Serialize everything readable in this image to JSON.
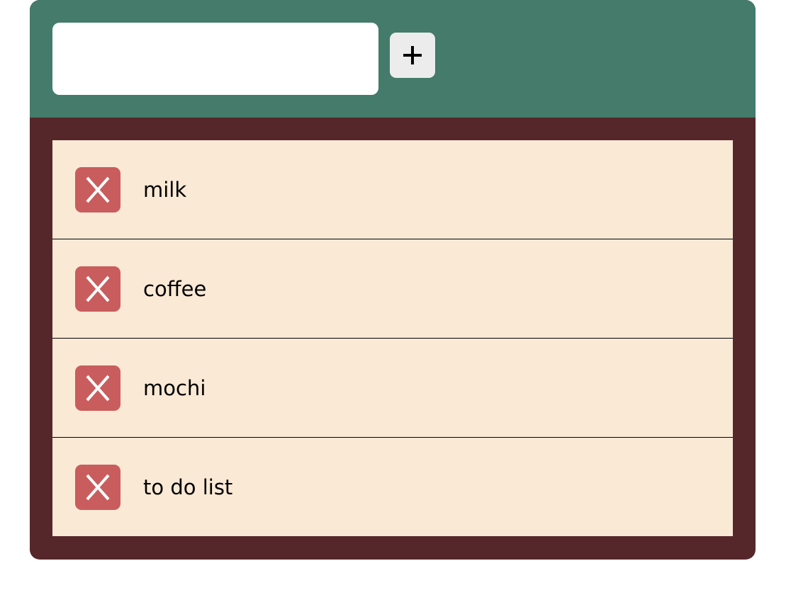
{
  "input": {
    "value": "",
    "placeholder": ""
  },
  "add_button": {
    "icon": "plus-icon"
  },
  "items": [
    {
      "label": "milk",
      "delete_icon": "x-icon"
    },
    {
      "label": "coffee",
      "delete_icon": "x-icon"
    },
    {
      "label": "mochi",
      "delete_icon": "x-icon"
    },
    {
      "label": "to do list",
      "delete_icon": "x-icon"
    }
  ],
  "colors": {
    "header_background": "#447b6a",
    "list_border": "#55272a",
    "item_background": "#f9e9d5",
    "delete_button": "#c95d5d",
    "add_button": "#ececec"
  }
}
